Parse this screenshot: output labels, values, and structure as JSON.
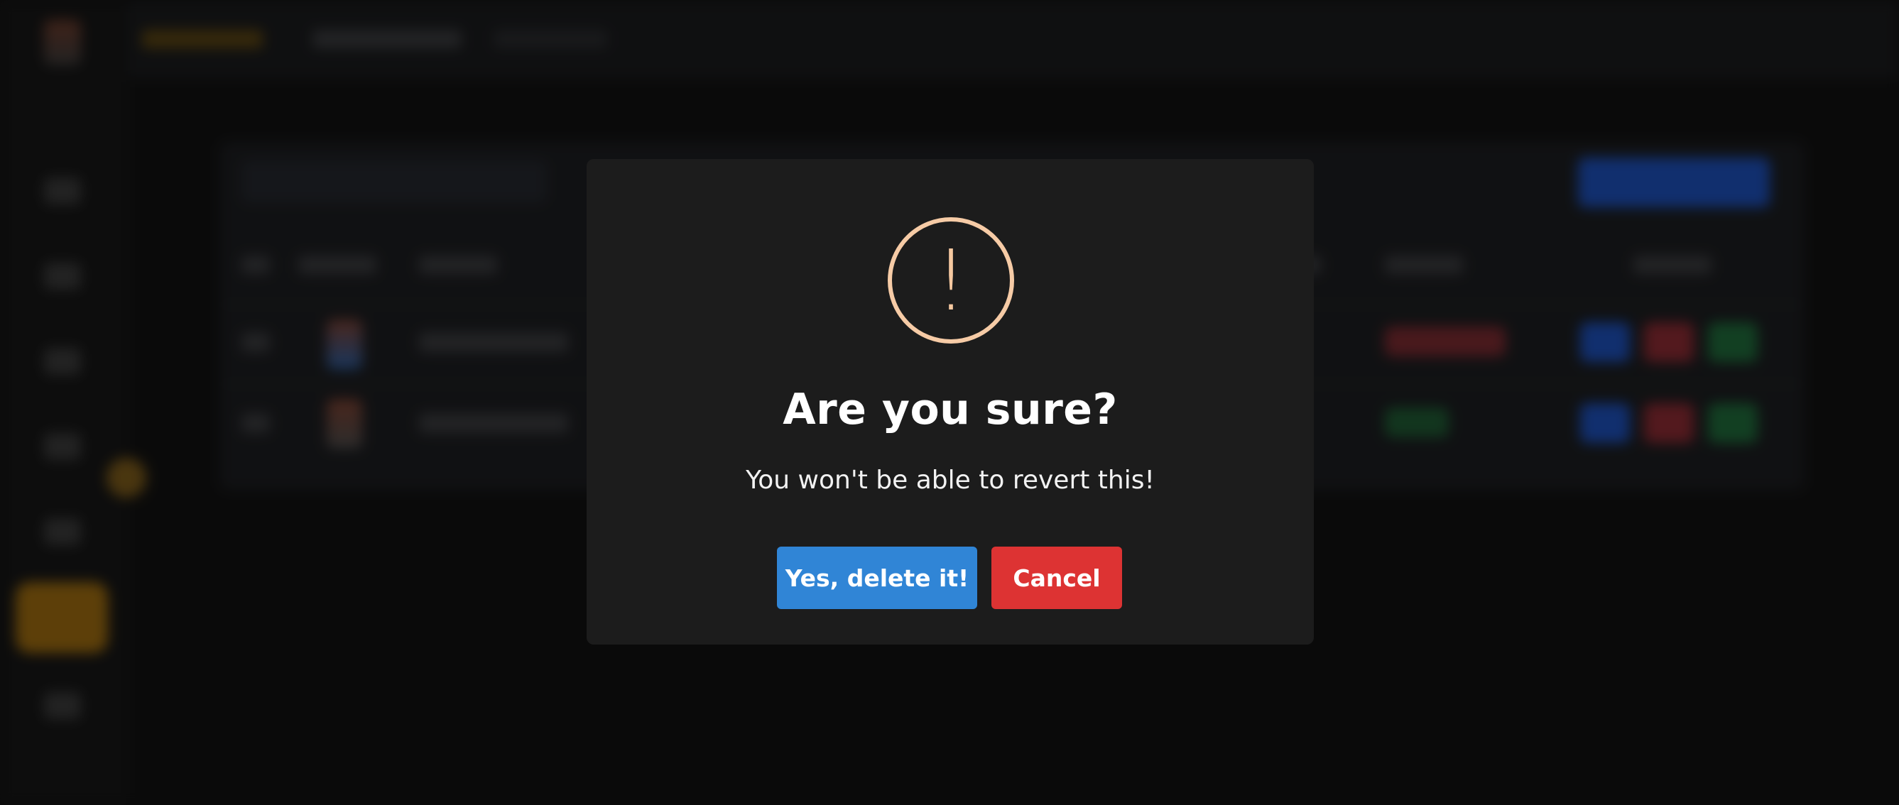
{
  "dialog": {
    "icon": "exclamation-icon",
    "icon_glyph": "!",
    "title": "Are you sure?",
    "message": "You won't be able to revert this!",
    "confirm_label": "Yes, delete it!",
    "cancel_label": "Cancel"
  },
  "colors": {
    "confirm": "#3085d6",
    "cancel": "#dd3333",
    "warning_icon": "#f6cba6",
    "dialog_bg": "#1c1c1c",
    "page_bg": "#121212"
  }
}
